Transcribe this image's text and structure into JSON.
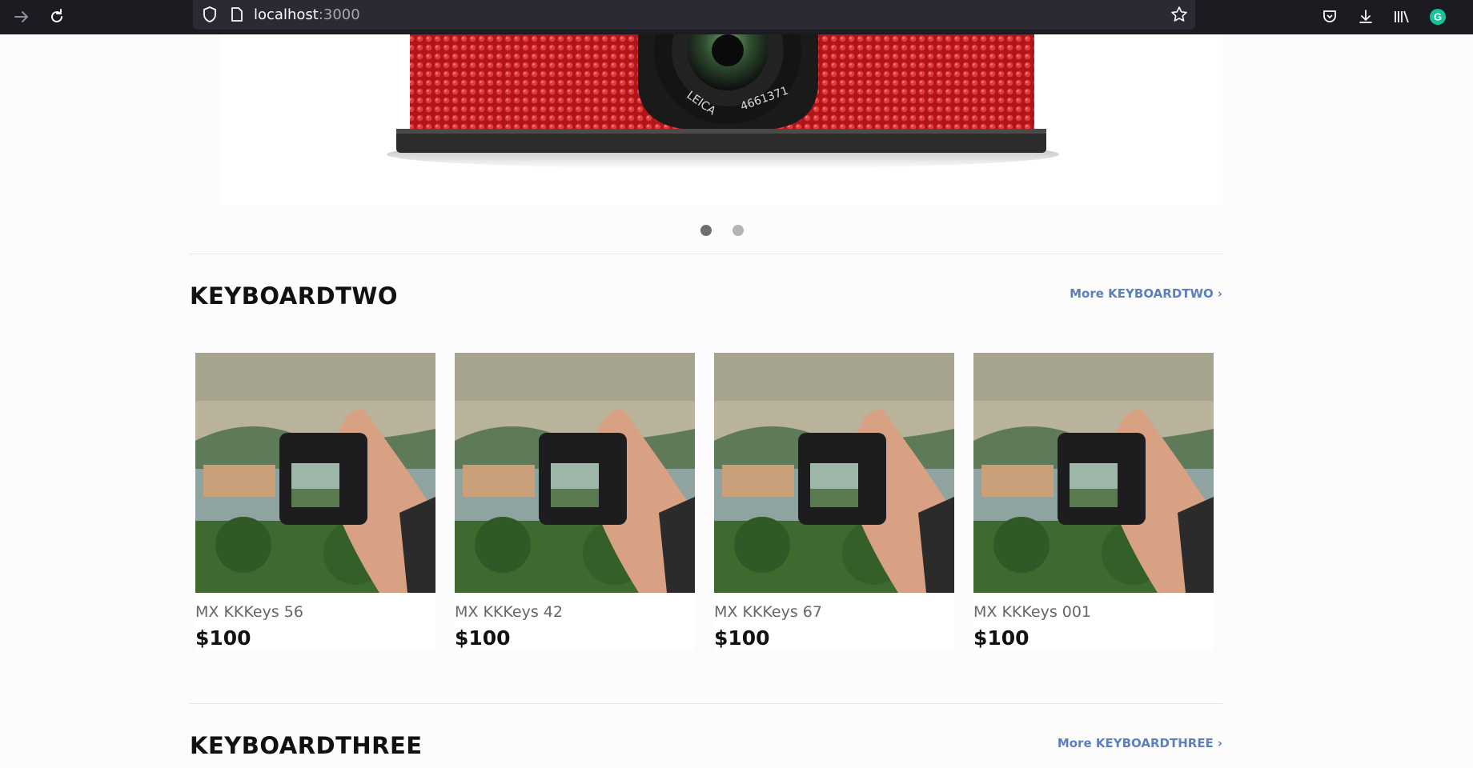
{
  "browser": {
    "url_host": "localhost",
    "url_port": ":3000",
    "icons": [
      "forward-icon",
      "reload-icon",
      "shield-icon",
      "page-icon",
      "bookmark-star-icon",
      "pocket-icon",
      "download-icon",
      "library-icon",
      "grammarly-icon"
    ]
  },
  "carousel": {
    "image": "camera-product-image",
    "dots": [
      {
        "active": true
      },
      {
        "active": false
      }
    ]
  },
  "sections": [
    {
      "title": "KEYBOARDTWO",
      "more_label": "More KEYBOARDTWO",
      "products": [
        {
          "name": "MX KKKeys 56",
          "price": "$100"
        },
        {
          "name": "MX KKKeys 42",
          "price": "$100"
        },
        {
          "name": "MX KKKeys 67",
          "price": "$100"
        },
        {
          "name": "MX KKKeys 001",
          "price": "$100"
        }
      ]
    },
    {
      "title": "KEYBOARDTHREE",
      "more_label": "More KEYBOARDTHREE"
    }
  ],
  "colors": {
    "link": "#5b7fbf",
    "toolbar": "#1c1b22",
    "camera_red": "#c91f1f"
  }
}
